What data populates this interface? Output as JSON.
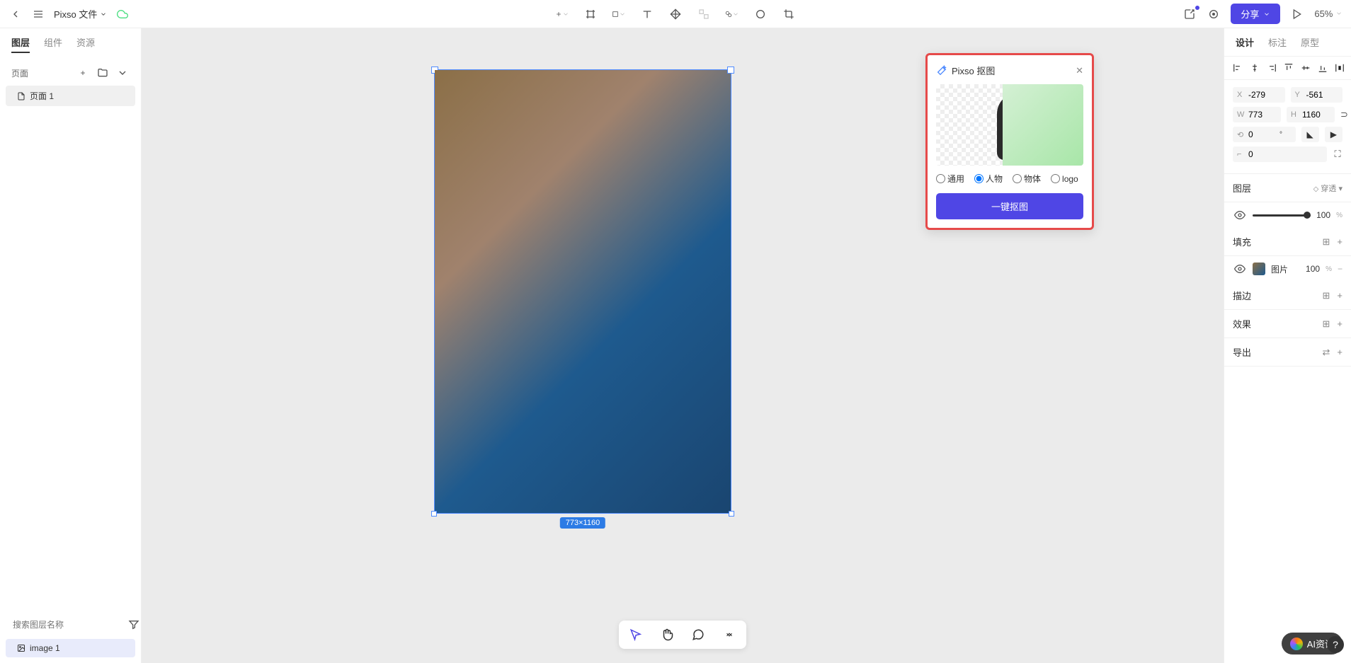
{
  "header": {
    "file_name": "Pixso 文件",
    "share_label": "分享",
    "zoom": "65%"
  },
  "left_panel": {
    "tabs": [
      "图层",
      "组件",
      "资源"
    ],
    "pages_label": "页面",
    "pages": [
      "页面 1"
    ],
    "search_placeholder": "搜索图层名称",
    "layers": [
      "image 1"
    ]
  },
  "canvas": {
    "selection_dims": "773×1160"
  },
  "popup": {
    "title": "Pixso 抠图",
    "radios": [
      "通用",
      "人物",
      "物体",
      "logo"
    ],
    "button": "一键抠图"
  },
  "right_panel": {
    "tabs": [
      "设计",
      "标注",
      "原型"
    ],
    "x": "-279",
    "y": "-561",
    "w": "773",
    "h": "1160",
    "rotation": "0",
    "radius": "0",
    "section_layer": "图层",
    "layer_mode": "穿透",
    "opacity": "100",
    "section_fill": "填充",
    "fill_type": "图片",
    "fill_opacity": "100",
    "section_stroke": "描边",
    "section_effect": "效果",
    "section_export": "导出"
  },
  "watermark": "AI资讯"
}
